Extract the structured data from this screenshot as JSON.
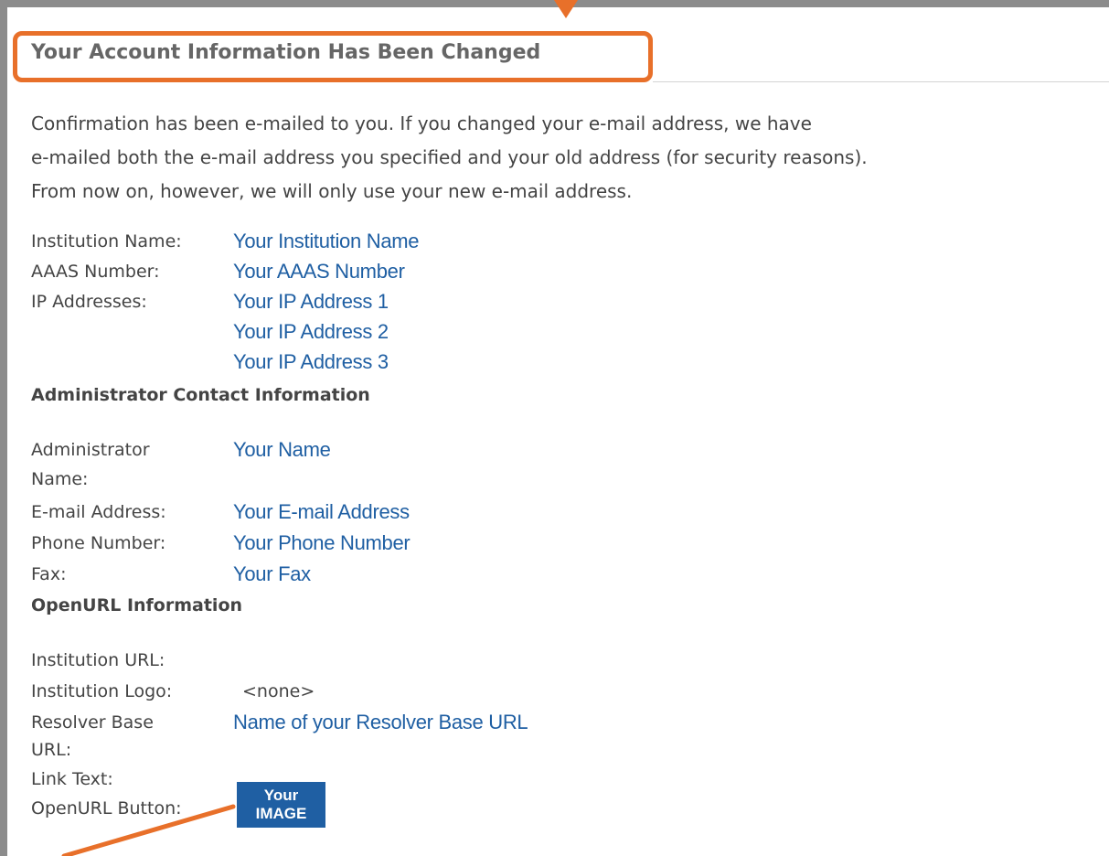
{
  "heading": "Your Account Information Has Been Changed",
  "intro": [
    "Confirmation has been e-mailed to you. If you changed your e-mail address, we have",
    "e-mailed both the e-mail address you specified and your old address (for security reasons).",
    "From now on, however, we will only use your new e-mail address."
  ],
  "institution": {
    "name_label": "Institution Name:",
    "name_value": "Your Institution Name",
    "aaas_label": "AAAS Number:",
    "aaas_value": "Your AAAS Number",
    "ip_label": "IP Addresses:",
    "ip_values": [
      "Your IP Address 1",
      "Your IP Address 2",
      "Your IP Address 3"
    ]
  },
  "admin": {
    "section_title": "Administrator Contact Information",
    "name_label_line1": "Administrator",
    "name_label_line2": "Name:",
    "name_value": "Your Name",
    "email_label": "E-mail Address:",
    "email_value": "Your E-mail Address",
    "phone_label": "Phone Number:",
    "phone_value": "Your Phone Number",
    "fax_label": "Fax:",
    "fax_value": "Your Fax"
  },
  "openurl": {
    "section_title": "OpenURL Information",
    "institution_url_label": "Institution URL:",
    "institution_logo_label": "Institution Logo:",
    "institution_logo_value": "<none>",
    "resolver_label_line1": "Resolver Base",
    "resolver_label_line2": "URL:",
    "resolver_value": "Name of your Resolver Base URL",
    "link_text_label": "Link Text:",
    "button_label": "OpenURL Button:",
    "button_image_line1": "Your",
    "button_image_line2": "IMAGE"
  },
  "colors": {
    "accent_orange": "#e8702a",
    "value_blue": "#1f5fa3",
    "label_gray": "#444444",
    "frame_gray": "#8c8c8c"
  },
  "icons": {
    "top_arrow": "arrow-down-icon",
    "bottom_arrow": "curved-arrow-icon"
  }
}
